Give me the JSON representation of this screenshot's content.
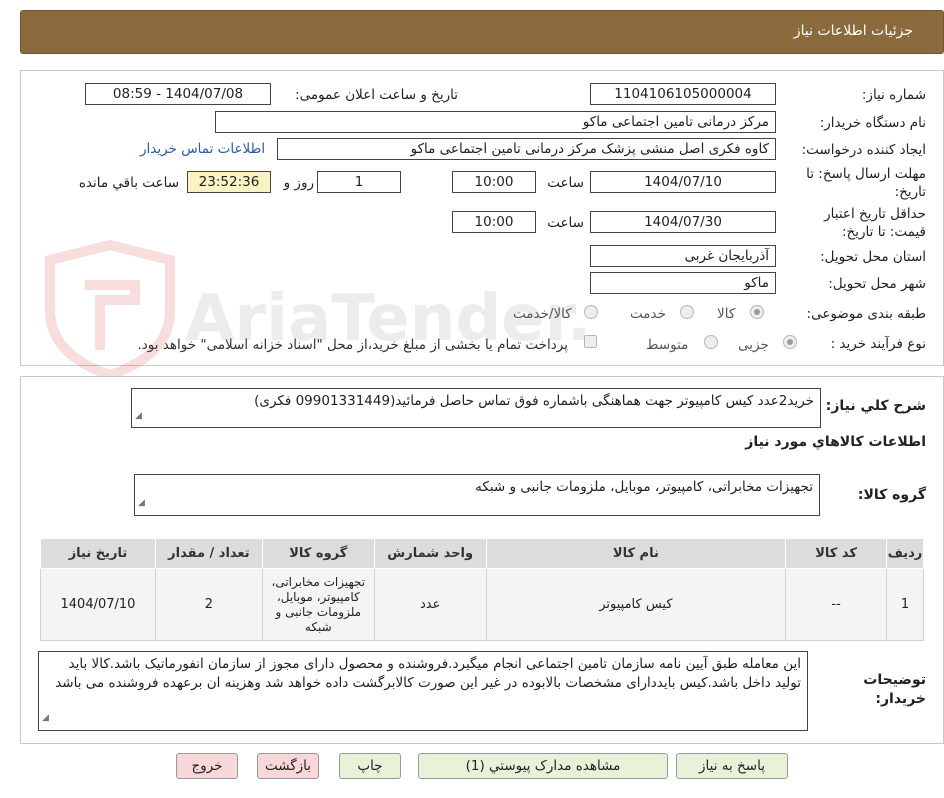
{
  "header": {
    "title": "جزئیات اطلاعات نیاز"
  },
  "watermark_text": "AriaTender.neT",
  "fields": {
    "need_number_label": "شماره نیاز:",
    "need_number": "1104106105000004",
    "announce_label": "تاریخ و ساعت اعلان عمومی:",
    "announce_value": "1404/07/08 - 08:59",
    "buyer_org_label": "نام دستگاه خریدار:",
    "buyer_org": "مرکز درمانی تامین اجتماعی ماکو",
    "creator_label": "ایجاد کننده درخواست:",
    "creator": "کاوه فکری اصل منشی پزشک مرکز درمانی تامین اجتماعی ماکو",
    "contact_link": "اطلاعات تماس خریدار",
    "send_deadline_label_1": "مهلت ارسال پاسخ: تا",
    "send_deadline_label_2": "تاریخ:",
    "send_deadline_date": "1404/07/10",
    "time_label": "ساعت",
    "send_deadline_time": "10:00",
    "days_value": "1",
    "days_label": "روز و",
    "remaining_time": "23:52:36",
    "remaining_label": "ساعت باقي مانده",
    "validity_label_1": "حداقل تاریخ اعتبار",
    "validity_label_2": "قیمت: تا تاریخ:",
    "validity_date": "1404/07/30",
    "validity_time": "10:00",
    "province_label": "استان محل تحویل:",
    "province": "آذربایجان غربی",
    "city_label": "شهر محل تحویل:",
    "city": "ماکو",
    "category_label": "طبقه بندی موضوعی:",
    "category_options": [
      "کالا",
      "خدمت",
      "کالا/خدمت"
    ],
    "purchase_type_label": "نوع فرآیند خرید :",
    "purchase_type_options": [
      "جزیی",
      "متوسط"
    ],
    "payment_note": "پرداخت تمام یا بخشی از مبلغ خرید،از محل \"اسناد خزانه اسلامی\" خواهد بود."
  },
  "summary": {
    "label": "شرح کلي نياز:",
    "text": "خرید2عدد کیس کامپیوتر                    جهت هماهنگی باشماره فوق تماس حاصل فرمائید(09901331449 فکری)"
  },
  "goods_section_title": "اطلاعات کالاهاي مورد نياز",
  "goods_group": {
    "label": "گروه کالا:",
    "value": "تجهیزات مخابراتی، کامپیوتر، موبایل، ملزومات جانبی و شبکه"
  },
  "table": {
    "headers": [
      "ردیف",
      "کد کالا",
      "نام کالا",
      "واحد شمارش",
      "گروه کالا",
      "تعداد / مقدار",
      "تاریخ نیاز"
    ],
    "rows": [
      [
        "1",
        "--",
        "کیس کامپیوتر",
        "عدد",
        "تجهیزات مخابراتی، کامپیوتر، موبایل، ملزومات جانبی و شبکه",
        "2",
        "1404/07/10"
      ]
    ]
  },
  "buyer_notes": {
    "label_1": "توضیحات",
    "label_2": "خریدار:",
    "text": "این معامله طبق آیین نامه سازمان تامین اجتماعی انجام میگیرد.فروشنده و محصول دارای مجوز از سازمان انفورماتیک باشد.کالا باید تولید داخل باشد.کیس بایددارای مشخصات بالابوده در غیر این صورت کالابرگشت داده خواهد شد وهزینه ان برعهده فروشنده می باشد"
  },
  "buttons": {
    "reply": "پاسخ به نیاز",
    "attachments": "مشاهده مدارک پیوستي (1)",
    "print": "چاپ",
    "back": "بازگشت",
    "exit": "خروج"
  }
}
